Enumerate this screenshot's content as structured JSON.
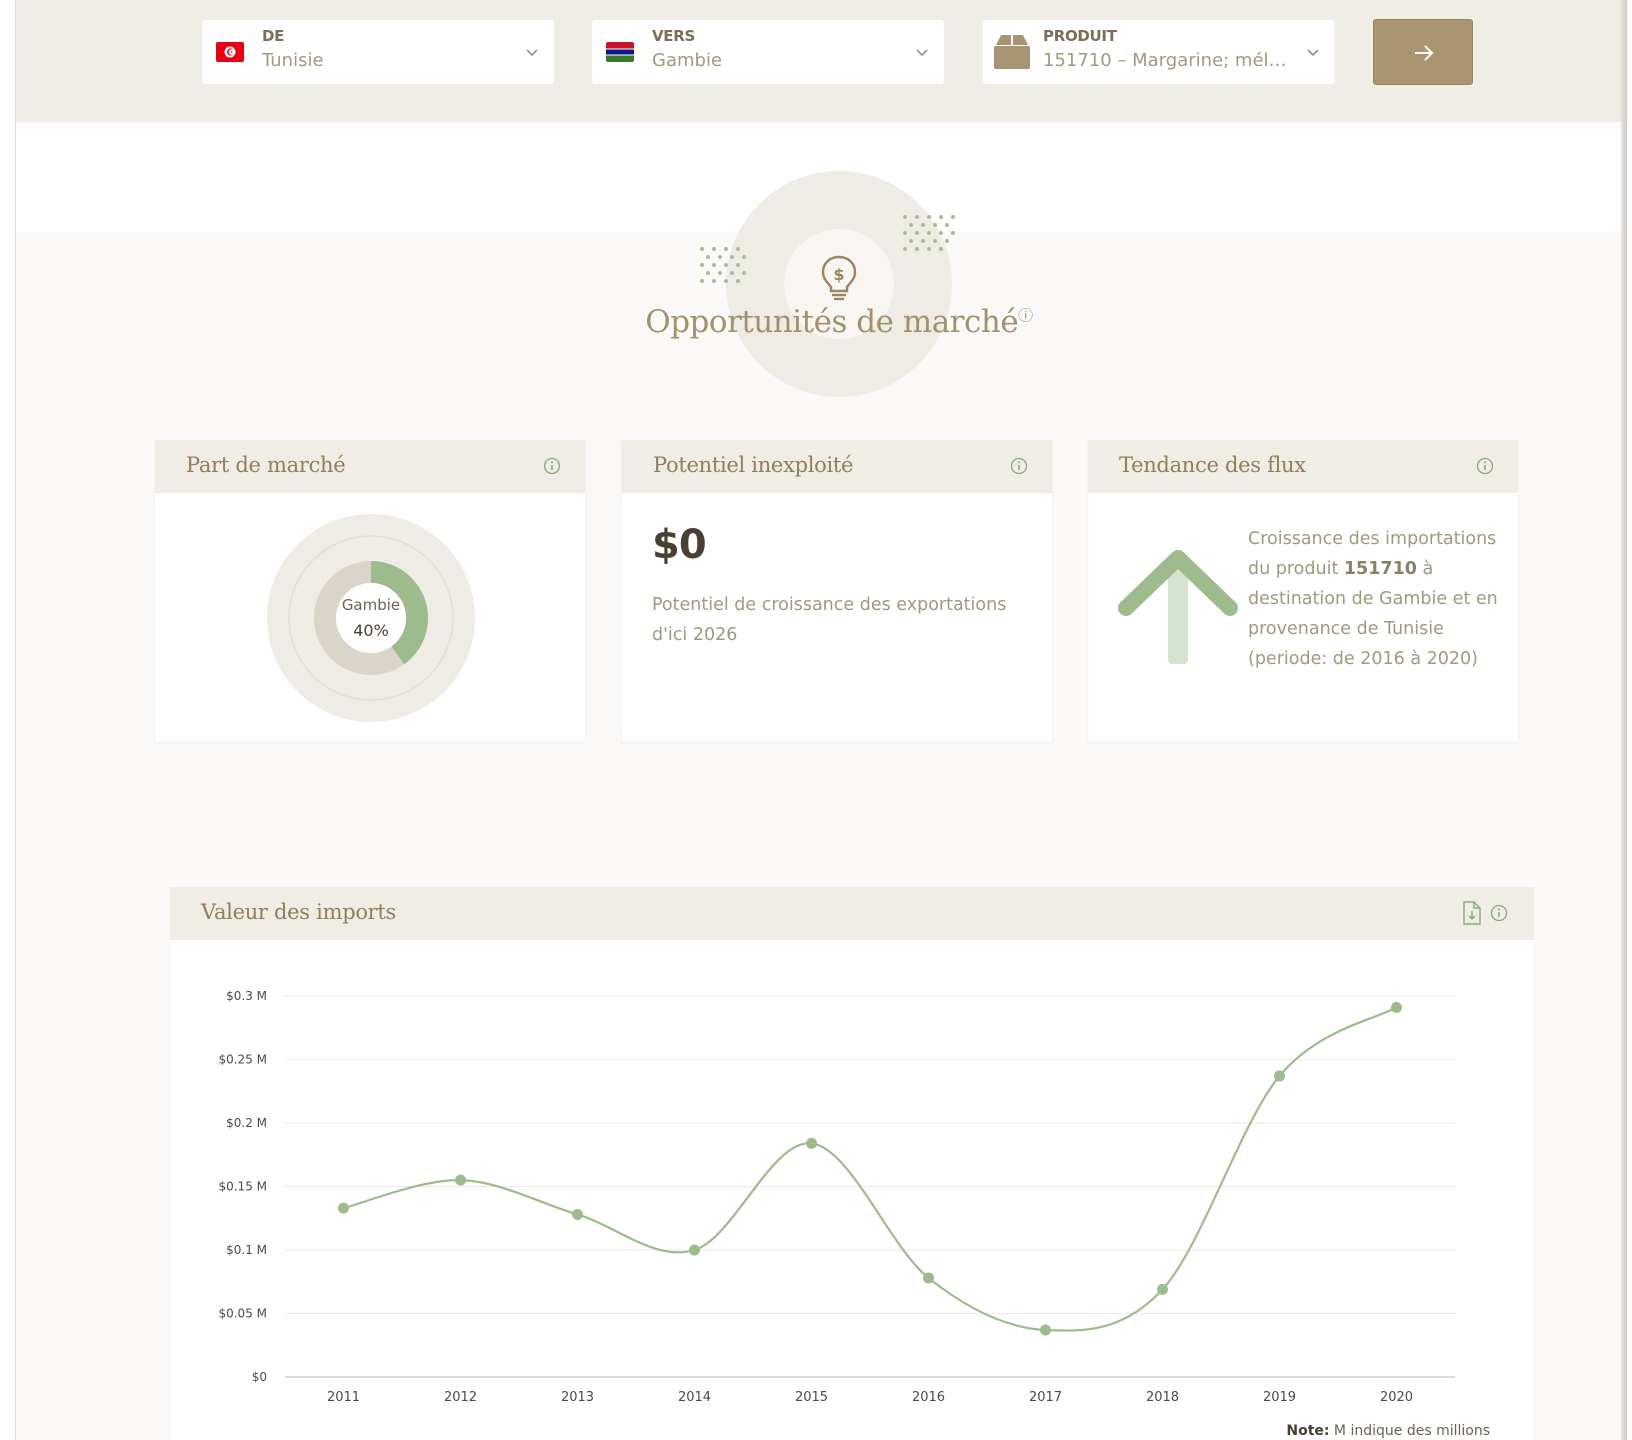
{
  "selectors": {
    "from": {
      "label": "DE",
      "value": "Tunisie",
      "flag": "tunisia-flag"
    },
    "to": {
      "label": "VERS",
      "value": "Gambie",
      "flag": "gambia-flag"
    },
    "product": {
      "label": "PRODUIT",
      "value": "151710 – Margarine; méla...",
      "icon": "box-icon"
    },
    "go_icon": "arrow-right-icon"
  },
  "hero": {
    "title": "Opportunités de marché",
    "icon": "lightbulb-dollar-icon",
    "info_icon": "info-icon"
  },
  "cards": {
    "market_share": {
      "title": "Part de marché",
      "donut_label": "Gambie",
      "donut_value": "40%",
      "share_fraction": 0.4
    },
    "untapped": {
      "title": "Potentiel inexploité",
      "value": "$0",
      "desc": "Potentiel de croissance des exportations d'ici 2026"
    },
    "trend": {
      "title": "Tendance des flux",
      "direction": "up",
      "text_before": "Croissance des importations du produit ",
      "product_code": "151710",
      "text_after": " à destination de Gambie et en provenance de Tunisie (periode: de 2016 à 2020)"
    }
  },
  "import_chart": {
    "title": "Valeur des imports",
    "note_label": "Note:",
    "note_text": " M indique des millions"
  },
  "colors": {
    "accent": "#ab9570",
    "series": "#9dbb8c",
    "title": "#a4916c",
    "header_bg": "#f0ede6"
  },
  "chart_data": {
    "type": "line",
    "title": "Valeur des imports",
    "x": [
      "2011",
      "2012",
      "2013",
      "2014",
      "2015",
      "2016",
      "2017",
      "2018",
      "2019",
      "2020"
    ],
    "values": [
      0.133,
      0.155,
      0.128,
      0.1,
      0.184,
      0.078,
      0.037,
      0.069,
      0.237,
      0.291
    ],
    "yticks": [
      "$0",
      "$0.05 M",
      "$0.1 M",
      "$0.15 M",
      "$0.2 M",
      "$0.25 M",
      "$0.3 M"
    ],
    "ylim": [
      0,
      0.3
    ],
    "unit": "millions USD",
    "grid": true
  }
}
